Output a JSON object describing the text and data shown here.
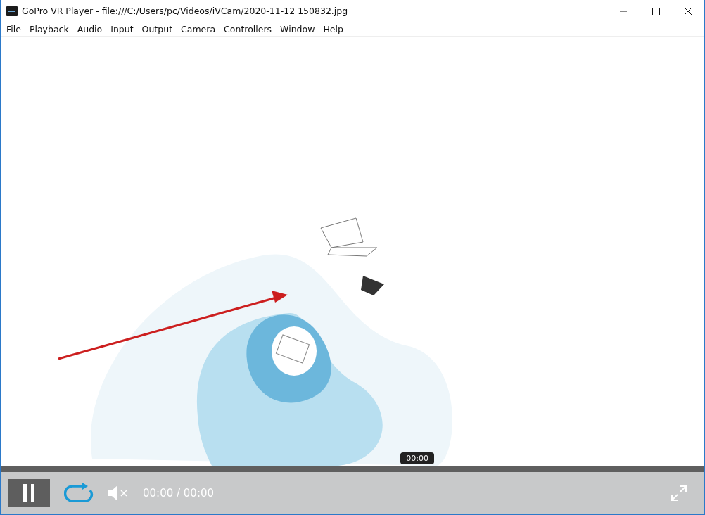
{
  "window": {
    "title": "GoPro VR Player - file:///C:/Users/pc/Videos/iVCam/2020-11-12 150832.jpg"
  },
  "menu": [
    {
      "label": "File"
    },
    {
      "label": "Playback"
    },
    {
      "label": "Audio"
    },
    {
      "label": "Input"
    },
    {
      "label": "Output"
    },
    {
      "label": "Camera"
    },
    {
      "label": "Controllers"
    },
    {
      "label": "Window"
    },
    {
      "label": "Help"
    }
  ],
  "seek": {
    "tooltip": "00:00"
  },
  "controls": {
    "playing": true,
    "loop": true,
    "muted": true,
    "time": "00:00 / 00:00"
  }
}
